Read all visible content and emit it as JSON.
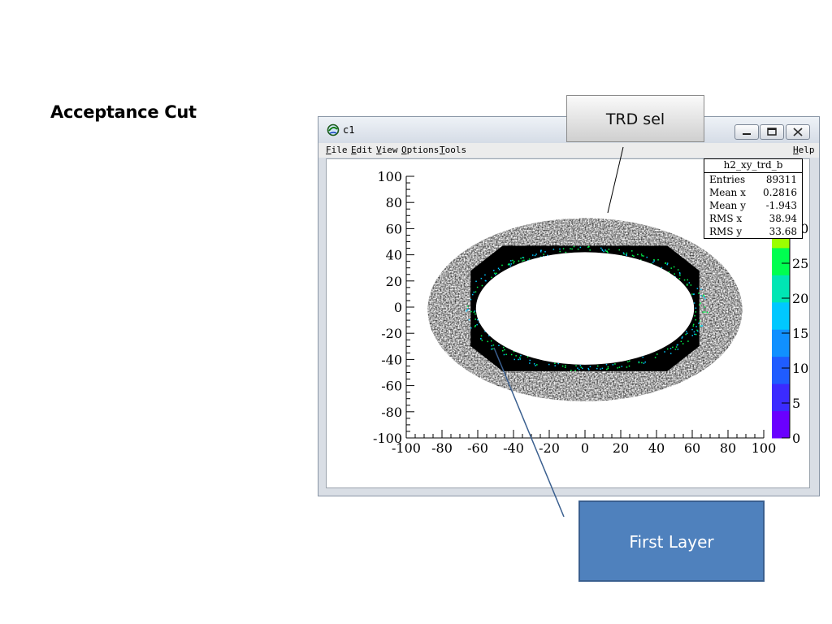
{
  "slide": {
    "title": "Acceptance Cut"
  },
  "window": {
    "title": "c1",
    "menu": [
      {
        "label": "File",
        "key": "F",
        "rest": "ile"
      },
      {
        "label": "Edit",
        "key": "E",
        "rest": "dit"
      },
      {
        "label": "View",
        "key": "V",
        "rest": "iew"
      },
      {
        "label": "Options",
        "key": "O",
        "rest": "ptions"
      },
      {
        "label": "Tools",
        "key": "T",
        "rest": "ools"
      }
    ],
    "help": {
      "label": "Help",
      "key": "H",
      "rest": "elp"
    },
    "buttons": [
      "minimize",
      "maximize",
      "close"
    ]
  },
  "stats": {
    "title": "h2_xy_trd_b",
    "rows": [
      {
        "label": "Entries",
        "value": "89311"
      },
      {
        "label": "Mean x",
        "value": "0.2816"
      },
      {
        "label": "Mean y",
        "value": "-1.943"
      },
      {
        "label": "RMS x",
        "value": "38.94"
      },
      {
        "label": "RMS y",
        "value": "33.68"
      }
    ]
  },
  "callouts": {
    "top": "TRD sel",
    "bottom": "First Layer"
  },
  "chart_data": {
    "type": "heatmap",
    "title": "",
    "xlabel": "",
    "ylabel": "",
    "xlim": [
      -100,
      100
    ],
    "ylim": [
      -100,
      100
    ],
    "xticks": [
      "-100",
      "-80",
      "-60",
      "-40",
      "-20",
      "0",
      "20",
      "40",
      "60",
      "80",
      "100"
    ],
    "yticks": [
      "100",
      "80",
      "60",
      "40",
      "20",
      "0",
      "-20",
      "-40",
      "-60",
      "-80",
      "-100"
    ],
    "colorbar_ticks": [
      "0",
      "5",
      "10",
      "15",
      "20",
      "25",
      "30"
    ],
    "colorbar_range": [
      0,
      35
    ],
    "color_palette": [
      "#6a00ff",
      "#3b2bff",
      "#1f5cff",
      "#1090ff",
      "#00c8ff",
      "#00e6b4",
      "#00ff50",
      "#9cff00",
      "#e6ff00"
    ],
    "grid": false,
    "regions": [
      {
        "name": "outer-band",
        "shape": "ellipse",
        "cx": 0,
        "cy": -2,
        "rx": 88,
        "ry": 70
      },
      {
        "name": "first-layer",
        "shape": "octagon",
        "xmin": -64,
        "xmax": 64,
        "ymin": -49,
        "ymax": 47,
        "color": "#000000"
      },
      {
        "name": "inner-hole",
        "shape": "ellipse",
        "cx": 0,
        "cy": -1,
        "rx": 61,
        "ry": 43
      }
    ]
  }
}
